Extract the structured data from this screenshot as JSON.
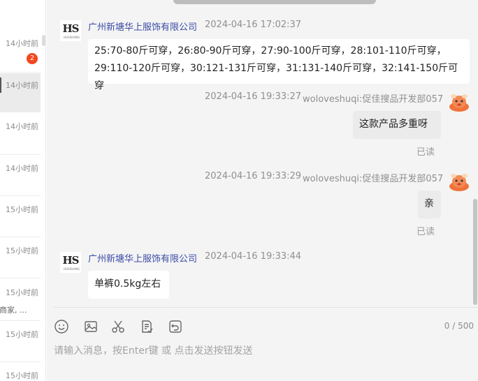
{
  "conversations": [
    {
      "time": "14小时前",
      "badge": "2",
      "preview": "",
      "active": false
    },
    {
      "time": "14小时前",
      "badge": "",
      "preview": "",
      "active": true
    },
    {
      "time": "14小时前",
      "badge": "",
      "preview": "",
      "active": false
    },
    {
      "time": "14小时前",
      "badge": "",
      "preview": "",
      "active": false
    },
    {
      "time": "15小时前",
      "badge": "",
      "preview": "",
      "active": false
    },
    {
      "time": "15小时前",
      "badge": "",
      "preview": "",
      "active": false
    },
    {
      "time": "15小时前",
      "badge": "",
      "preview": "商家, ...",
      "active": false
    },
    {
      "time": "15小时前",
      "badge": "",
      "preview": "",
      "active": false
    },
    {
      "time": "15小时前",
      "badge": "",
      "preview": "",
      "active": false
    }
  ],
  "messages": [
    {
      "sender": "广州新塘华上服饰有限公司",
      "time": "2024-04-16 17:02:37",
      "text": "25:70-80斤可穿，26:80-90斤可穿，27:90-100斤可穿，28:101-110斤可穿，29:110-120斤可穿，30:121-131斤可穿，31:131-140斤可穿，32:141-150斤可穿"
    },
    {
      "sender": "woloveshuqi:促佳搜品开发部057",
      "time": "2024-04-16 19:33:27",
      "text": "这款产品多重呀",
      "status": "已读"
    },
    {
      "sender": "woloveshuqi:促佳搜品开发部057",
      "time": "2024-04-16 19:33:29",
      "text": "亲",
      "status": "已读"
    },
    {
      "sender": "广州新塘华上服饰有限公司",
      "time": "2024-04-16 19:33:44",
      "text": "单裤0.5kg左右"
    }
  ],
  "avatar_hs": {
    "letters": "HS",
    "sub": "HUASHANG"
  },
  "input": {
    "placeholder": "请输入消息，按Enter键 或 点击发送按钮发送",
    "value": "",
    "counter": "0 / 500"
  },
  "toolbar": {
    "icons": [
      "emoji-icon",
      "image-icon",
      "scissors-icon",
      "order-icon",
      "undo-icon"
    ]
  },
  "colors": {
    "badge": "#f5461d",
    "sender": "#3c4ba6",
    "background": "#f4f4f4"
  }
}
